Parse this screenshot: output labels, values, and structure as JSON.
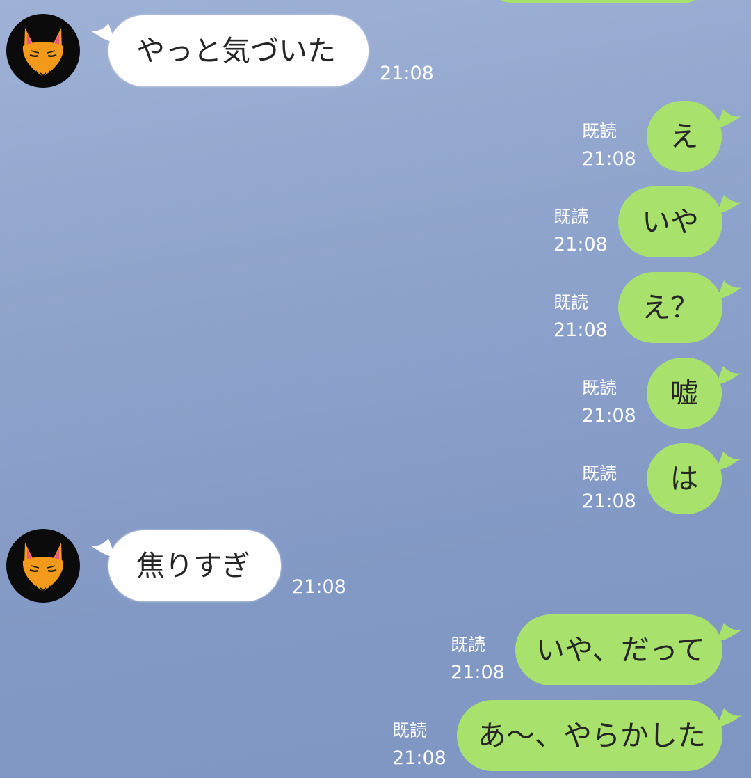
{
  "chat": {
    "background_color": "#8ea3cc",
    "incoming_bubble_color": "#ffffff",
    "outgoing_bubble_color": "#a8e26c",
    "messages": [
      {
        "direction": "incoming",
        "text": "やっと気づいた",
        "time": "21:08"
      },
      {
        "direction": "outgoing",
        "text": "え",
        "read": "既読",
        "time": "21:08"
      },
      {
        "direction": "outgoing",
        "text": "いや",
        "read": "既読",
        "time": "21:08"
      },
      {
        "direction": "outgoing",
        "text": "え？",
        "read": "既読",
        "time": "21:08"
      },
      {
        "direction": "outgoing",
        "text": "嘘",
        "read": "既読",
        "time": "21:08"
      },
      {
        "direction": "outgoing",
        "text": "は",
        "read": "既読",
        "time": "21:08"
      },
      {
        "direction": "incoming",
        "text": "焦りすぎ",
        "time": "21:08"
      },
      {
        "direction": "outgoing",
        "text": "いや、だって",
        "read": "既読",
        "time": "21:08"
      },
      {
        "direction": "outgoing",
        "text": "あ〜、やらかした",
        "read": "既読",
        "time": "21:08"
      }
    ]
  },
  "icons": {
    "avatar": "fox-face-icon",
    "bubble_tail": "speech-tail-icon"
  }
}
